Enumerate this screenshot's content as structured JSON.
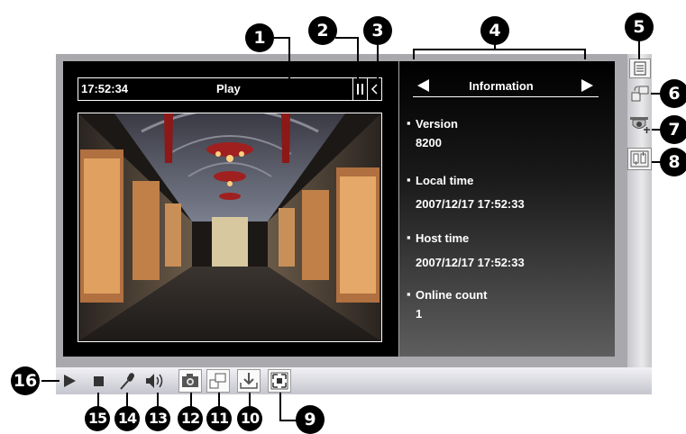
{
  "status_bar": {
    "time": "17:52:34",
    "state": "Play"
  },
  "info": {
    "title": "Information",
    "items": [
      {
        "label": "Version",
        "value": "8200"
      },
      {
        "label": "Local time",
        "value": "2007/12/17 17:52:33"
      },
      {
        "label": "Host time",
        "value": "2007/12/17 17:52:33"
      },
      {
        "label": "Online count",
        "value": "1"
      }
    ]
  },
  "callouts": [
    "1",
    "2",
    "3",
    "4",
    "5",
    "6",
    "7",
    "8",
    "9",
    "10",
    "11",
    "12",
    "13",
    "14",
    "15",
    "16"
  ],
  "icons": {
    "sidebar": [
      "list-icon",
      "swap-view-icon",
      "ptz-camera-icon",
      "digital-io-icon"
    ],
    "toolbar": [
      "play-icon",
      "stop-icon",
      "microphone-icon",
      "speaker-icon",
      "snapshot-icon",
      "view-size-icon",
      "download-icon",
      "fullscreen-icon"
    ]
  },
  "colors": {
    "frame": "#a9a9ad",
    "panel": "#000000",
    "text": "#ffffff"
  }
}
